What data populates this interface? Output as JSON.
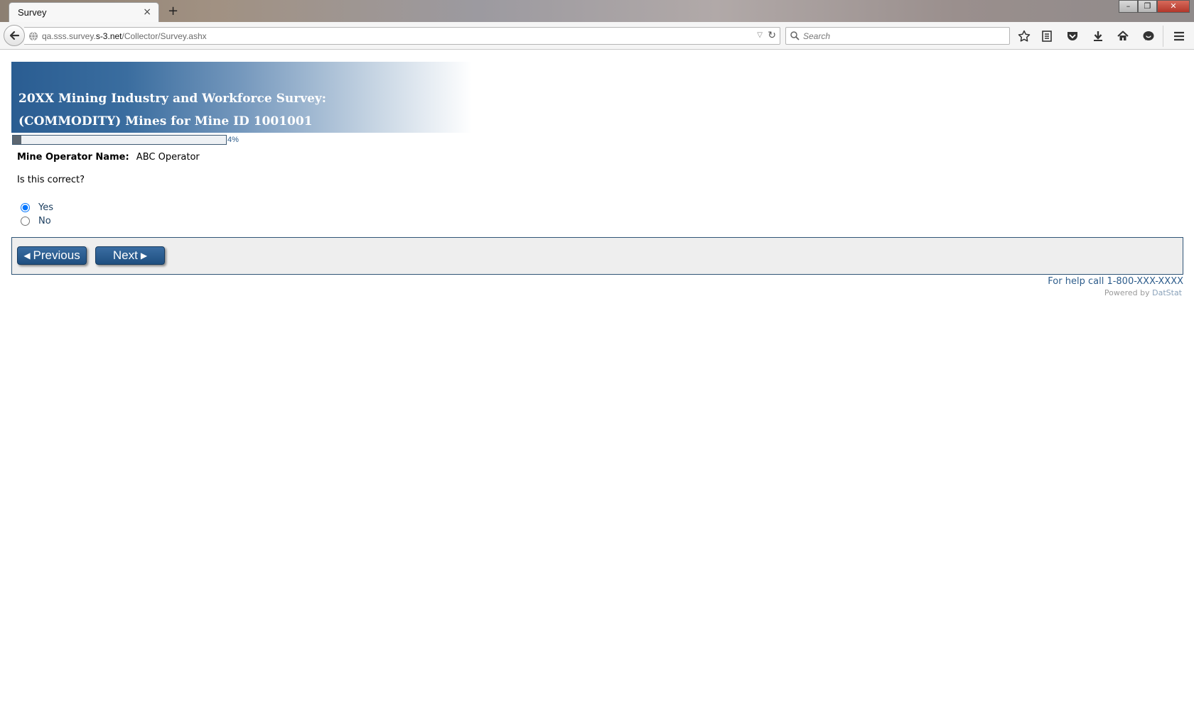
{
  "browser": {
    "tab_title": "Survey",
    "tab_close": "×",
    "new_tab": "+",
    "url_prefix": "qa.sss.survey.",
    "url_host": "s-3.net",
    "url_path": "/Collector/Survey.ashx",
    "search_placeholder": "Search",
    "window_controls": [
      "–",
      "❐",
      "✕"
    ]
  },
  "survey": {
    "title_line1": "20XX Mining Industry and Workforce Survey:",
    "title_line2": "(COMMODITY) Mines for Mine ID 1001001",
    "progress_percent": 4,
    "progress_label": "4%",
    "operator_label": "Mine Operator Name:",
    "operator_value": "ABC Operator",
    "question": "Is this correct?",
    "options": [
      {
        "label": "Yes",
        "selected": true
      },
      {
        "label": "No",
        "selected": false
      }
    ],
    "previous_label": "Previous",
    "next_label": "Next",
    "help_text": "For help call 1-800-XXX-XXXX",
    "powered_prefix": "Powered by",
    "powered_brand": "DatStat"
  },
  "colors": {
    "banner_dark": "#2a5d92",
    "button": "#1f4f80",
    "link": "#2d5c8b",
    "panel_bg": "#eeeeee"
  }
}
